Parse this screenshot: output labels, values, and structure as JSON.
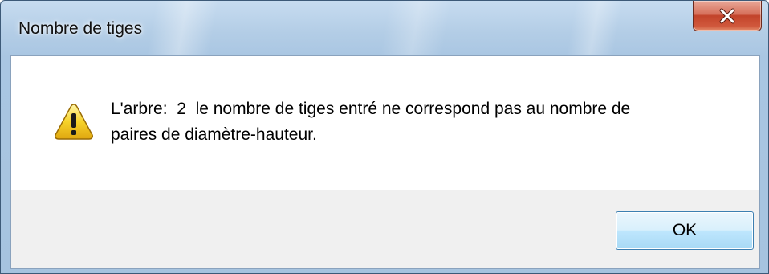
{
  "window": {
    "title": "Nombre de tiges"
  },
  "titlebar_buttons": {
    "close_icon": "close-icon"
  },
  "message": {
    "icon": "warning-icon",
    "text": "L'arbre:  2  le nombre de tiges entré ne correspond pas au nombre de\npaires de diamètre-hauteur."
  },
  "buttons": {
    "ok_label": "OK"
  },
  "colors": {
    "frame": "#a9c6e2",
    "close_button": "#c2432a",
    "button_area": "#f0f0f0",
    "ok_border": "#3c7fb1",
    "warning_yellow": "#f6d22a"
  }
}
